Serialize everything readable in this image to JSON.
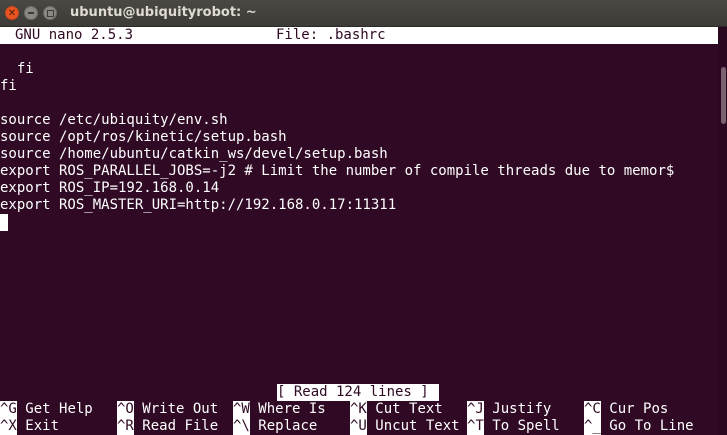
{
  "window": {
    "title": "ubuntu@ubiquityrobot: ~"
  },
  "nano": {
    "version": "GNU nano 2.5.3",
    "file_label": "File: .bashrc"
  },
  "buffer": [
    "",
    "  fi",
    "fi",
    "",
    "source /etc/ubiquity/env.sh",
    "source /opt/ros/kinetic/setup.bash",
    "source /home/ubuntu/catkin_ws/devel/setup.bash",
    "export ROS_PARALLEL_JOBS=-j2 # Limit the number of compile threads due to memor$",
    "export ROS_IP=192.168.0.14",
    "export ROS_MASTER_URI=http://192.168.0.17:11311"
  ],
  "status": "[ Read 124 lines ]",
  "shortcuts": [
    [
      {
        "key": "^G",
        "label": "Get Help"
      },
      {
        "key": "^O",
        "label": "Write Out"
      },
      {
        "key": "^W",
        "label": "Where Is"
      },
      {
        "key": "^K",
        "label": "Cut Text"
      },
      {
        "key": "^J",
        "label": "Justify"
      },
      {
        "key": "^C",
        "label": "Cur Pos"
      }
    ],
    [
      {
        "key": "^X",
        "label": "Exit"
      },
      {
        "key": "^R",
        "label": "Read File"
      },
      {
        "key": "^\\",
        "label": "Replace"
      },
      {
        "key": "^U",
        "label": "Uncut Text"
      },
      {
        "key": "^T",
        "label": "To Spell"
      },
      {
        "key": "^_",
        "label": "Go To Line"
      }
    ]
  ],
  "colors": {
    "terminal_bg": "#300a24",
    "terminal_fg": "#ffffff",
    "close_button": "#e95420"
  },
  "icons": [
    "close-icon",
    "minimize-icon",
    "maximize-icon"
  ]
}
